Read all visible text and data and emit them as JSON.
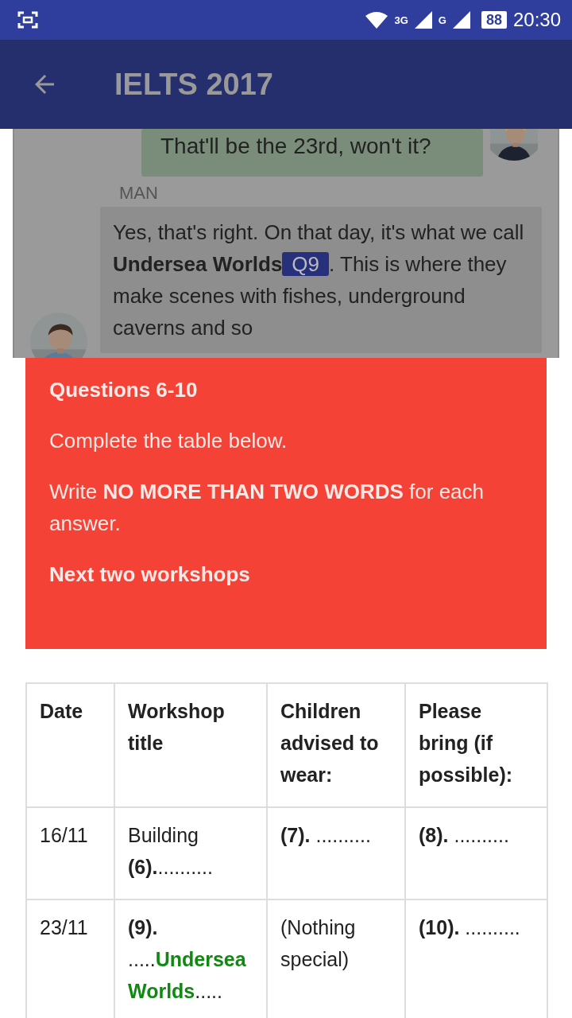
{
  "status_bar": {
    "network_1": "3G",
    "network_2": "G",
    "battery": "88",
    "time": "20:30"
  },
  "app_bar": {
    "title": "IELTS 2017"
  },
  "chat": [
    {
      "kind": "partner",
      "text": "That'll be the 23rd, won't it?"
    },
    {
      "kind": "speaker",
      "speaker": "MAN",
      "text": "Yes, that's right. On that day, it's what we call **Undersea Worlds**",
      "badge": "Q9",
      "text_after": ". This is where they make scenes with fishes, underground caverns and so"
    }
  ],
  "instructions": {
    "title": "Questions 6-10",
    "lines": [
      "Complete the table below.",
      "Write **NO MORE THAN TWO WORDS** for each answer."
    ],
    "subtitle": "Next two workshops"
  },
  "table": {
    "columns": [
      "Date",
      "Workshop title",
      "Children advised to wear:",
      "Please bring (if possible):"
    ],
    "rows": [
      [
        [
          {
            "kind": "plain",
            "text": "16/11"
          }
        ],
        [
          {
            "kind": "plain",
            "text": "Building "
          },
          {
            "kind": "bold",
            "text": "(6)."
          },
          {
            "kind": "plain",
            "text": ".........."
          }
        ],
        [
          {
            "kind": "bold",
            "text": "(7)."
          },
          {
            "kind": "plain",
            "text": " .........."
          }
        ],
        [
          {
            "kind": "bold",
            "text": "(8)."
          },
          {
            "kind": "plain",
            "text": " .........."
          }
        ]
      ],
      [
        [
          {
            "kind": "plain",
            "text": "23/11"
          }
        ],
        [
          {
            "kind": "bold",
            "text": "(9)."
          },
          {
            "kind": "plain",
            "text": " ....."
          },
          {
            "kind": "answer",
            "text": "Undersea Worlds"
          },
          {
            "kind": "plain",
            "text": "....."
          }
        ],
        [
          {
            "kind": "plain",
            "text": "(Nothing special)"
          }
        ],
        [
          {
            "kind": "bold",
            "text": "(10)."
          },
          {
            "kind": "plain",
            "text": " .........."
          }
        ]
      ]
    ]
  }
}
